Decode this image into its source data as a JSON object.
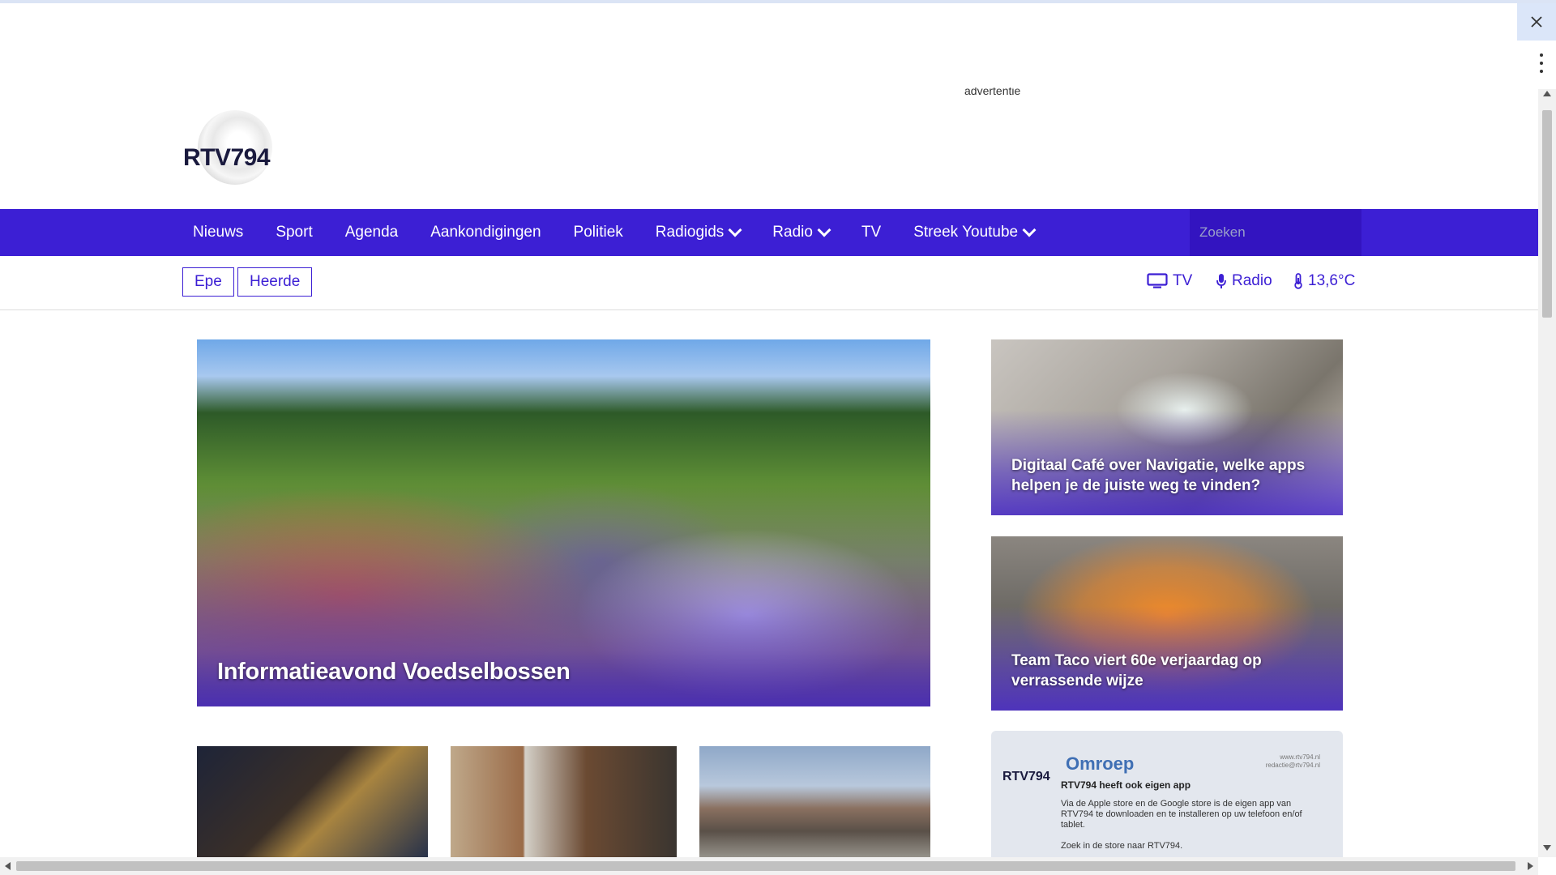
{
  "header": {
    "ad_label": "advertentie",
    "logo_text": "RTV794"
  },
  "nav": {
    "items": [
      {
        "label": "Nieuws",
        "dropdown": false
      },
      {
        "label": "Sport",
        "dropdown": false
      },
      {
        "label": "Agenda",
        "dropdown": false
      },
      {
        "label": "Aankondigingen",
        "dropdown": false
      },
      {
        "label": "Politiek",
        "dropdown": false
      },
      {
        "label": "Radiogids",
        "dropdown": true
      },
      {
        "label": "Radio",
        "dropdown": true
      },
      {
        "label": "TV",
        "dropdown": false
      },
      {
        "label": "Streek Youtube",
        "dropdown": true
      }
    ],
    "search_placeholder": "Zoeken"
  },
  "subbar": {
    "regions": [
      "Epe",
      "Heerde"
    ],
    "tv_label": "TV",
    "radio_label": "Radio",
    "temperature": "13,6°C"
  },
  "articles": {
    "hero": "Informatieavond Voedselbossen",
    "side1": "Digitaal Café over Navigatie, welke apps helpen je de juiste weg te vinden?",
    "side2": "Team Taco viert 60e verjaardag op verrassende wijze"
  },
  "promo": {
    "logo": "RTV794",
    "title": "Omroep",
    "url_line1": "www.rtv794.nl",
    "url_line2": "redactie@rtv794.nl",
    "subtitle": "RTV794 heeft ook eigen app",
    "body": "Via de Apple store en de Google store is de eigen app van RTV794 te downloaden en te installeren op uw telefoon en/of tablet.",
    "cta": "Zoek in de store naar RTV794."
  },
  "colors": {
    "brand": "#3c1fd4",
    "nav_bg": "#3c1fd4",
    "search_bg": "#3314c0"
  }
}
